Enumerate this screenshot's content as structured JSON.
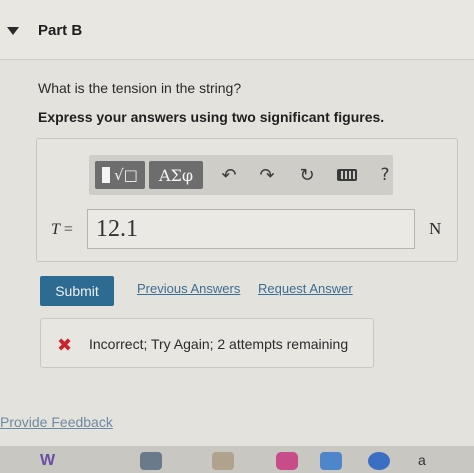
{
  "part": {
    "title": "Part B"
  },
  "question": {
    "prompt": "What is the tension in the string?",
    "instruction": "Express your answers using two significant figures."
  },
  "toolbar": {
    "greek_label": "ΑΣφ",
    "template_label": "√□",
    "help_label": "?",
    "icons": [
      "templates-icon",
      "greek-letters-icon",
      "undo-icon",
      "redo-icon",
      "reset-icon",
      "keyboard-icon",
      "help-icon"
    ]
  },
  "answer": {
    "variable": "T",
    "equals": "=",
    "value": "12.1",
    "unit": "N"
  },
  "actions": {
    "submit_label": "Submit",
    "previous_answers_label": "Previous Answers",
    "request_answer_label": "Request Answer"
  },
  "feedback": {
    "message": "Incorrect; Try Again; 2 attempts remaining",
    "status_color": "#c8262a"
  },
  "footer": {
    "provide_feedback_label": "Provide Feedback"
  },
  "taskbar": {
    "last_label": "a"
  }
}
